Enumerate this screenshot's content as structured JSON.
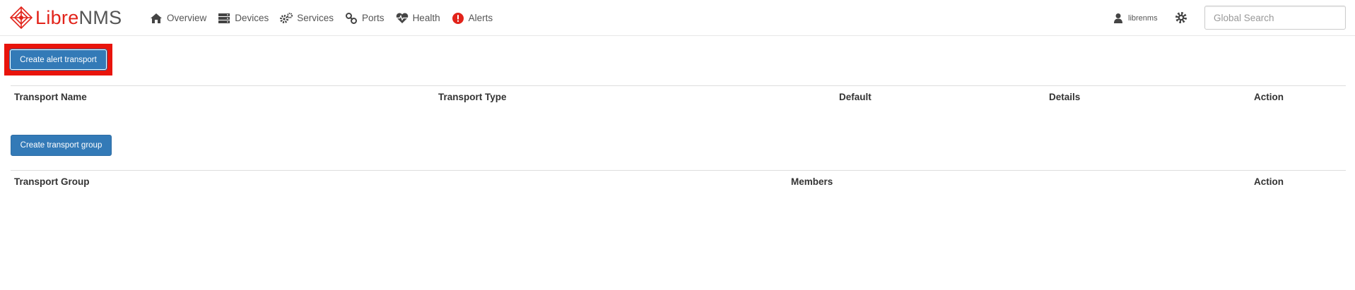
{
  "brand": {
    "libre": "Libre",
    "nms": "NMS",
    "accent": "#e2231a"
  },
  "nav": {
    "items": [
      {
        "label": "Overview",
        "icon": "home-icon"
      },
      {
        "label": "Devices",
        "icon": "server-icon"
      },
      {
        "label": "Services",
        "icon": "cogs-icon"
      },
      {
        "label": "Ports",
        "icon": "link-icon"
      },
      {
        "label": "Health",
        "icon": "heartbeat-icon"
      },
      {
        "label": "Alerts",
        "icon": "alert-icon"
      }
    ]
  },
  "user": {
    "name": "librenms",
    "icon": "user-icon"
  },
  "settings": {
    "icon": "gear-icon"
  },
  "search": {
    "placeholder": "Global Search",
    "value": ""
  },
  "transports": {
    "create_button": "Create alert transport",
    "columns": [
      "Transport Name",
      "Transport Type",
      "Default",
      "Details",
      "Action"
    ],
    "rows": []
  },
  "groups": {
    "create_button": "Create transport group",
    "columns": [
      "Transport Group",
      "Members",
      "Action"
    ],
    "rows": []
  },
  "colors": {
    "primary": "#337ab7",
    "highlight": "#e8140c",
    "alert": "#e2231a"
  }
}
